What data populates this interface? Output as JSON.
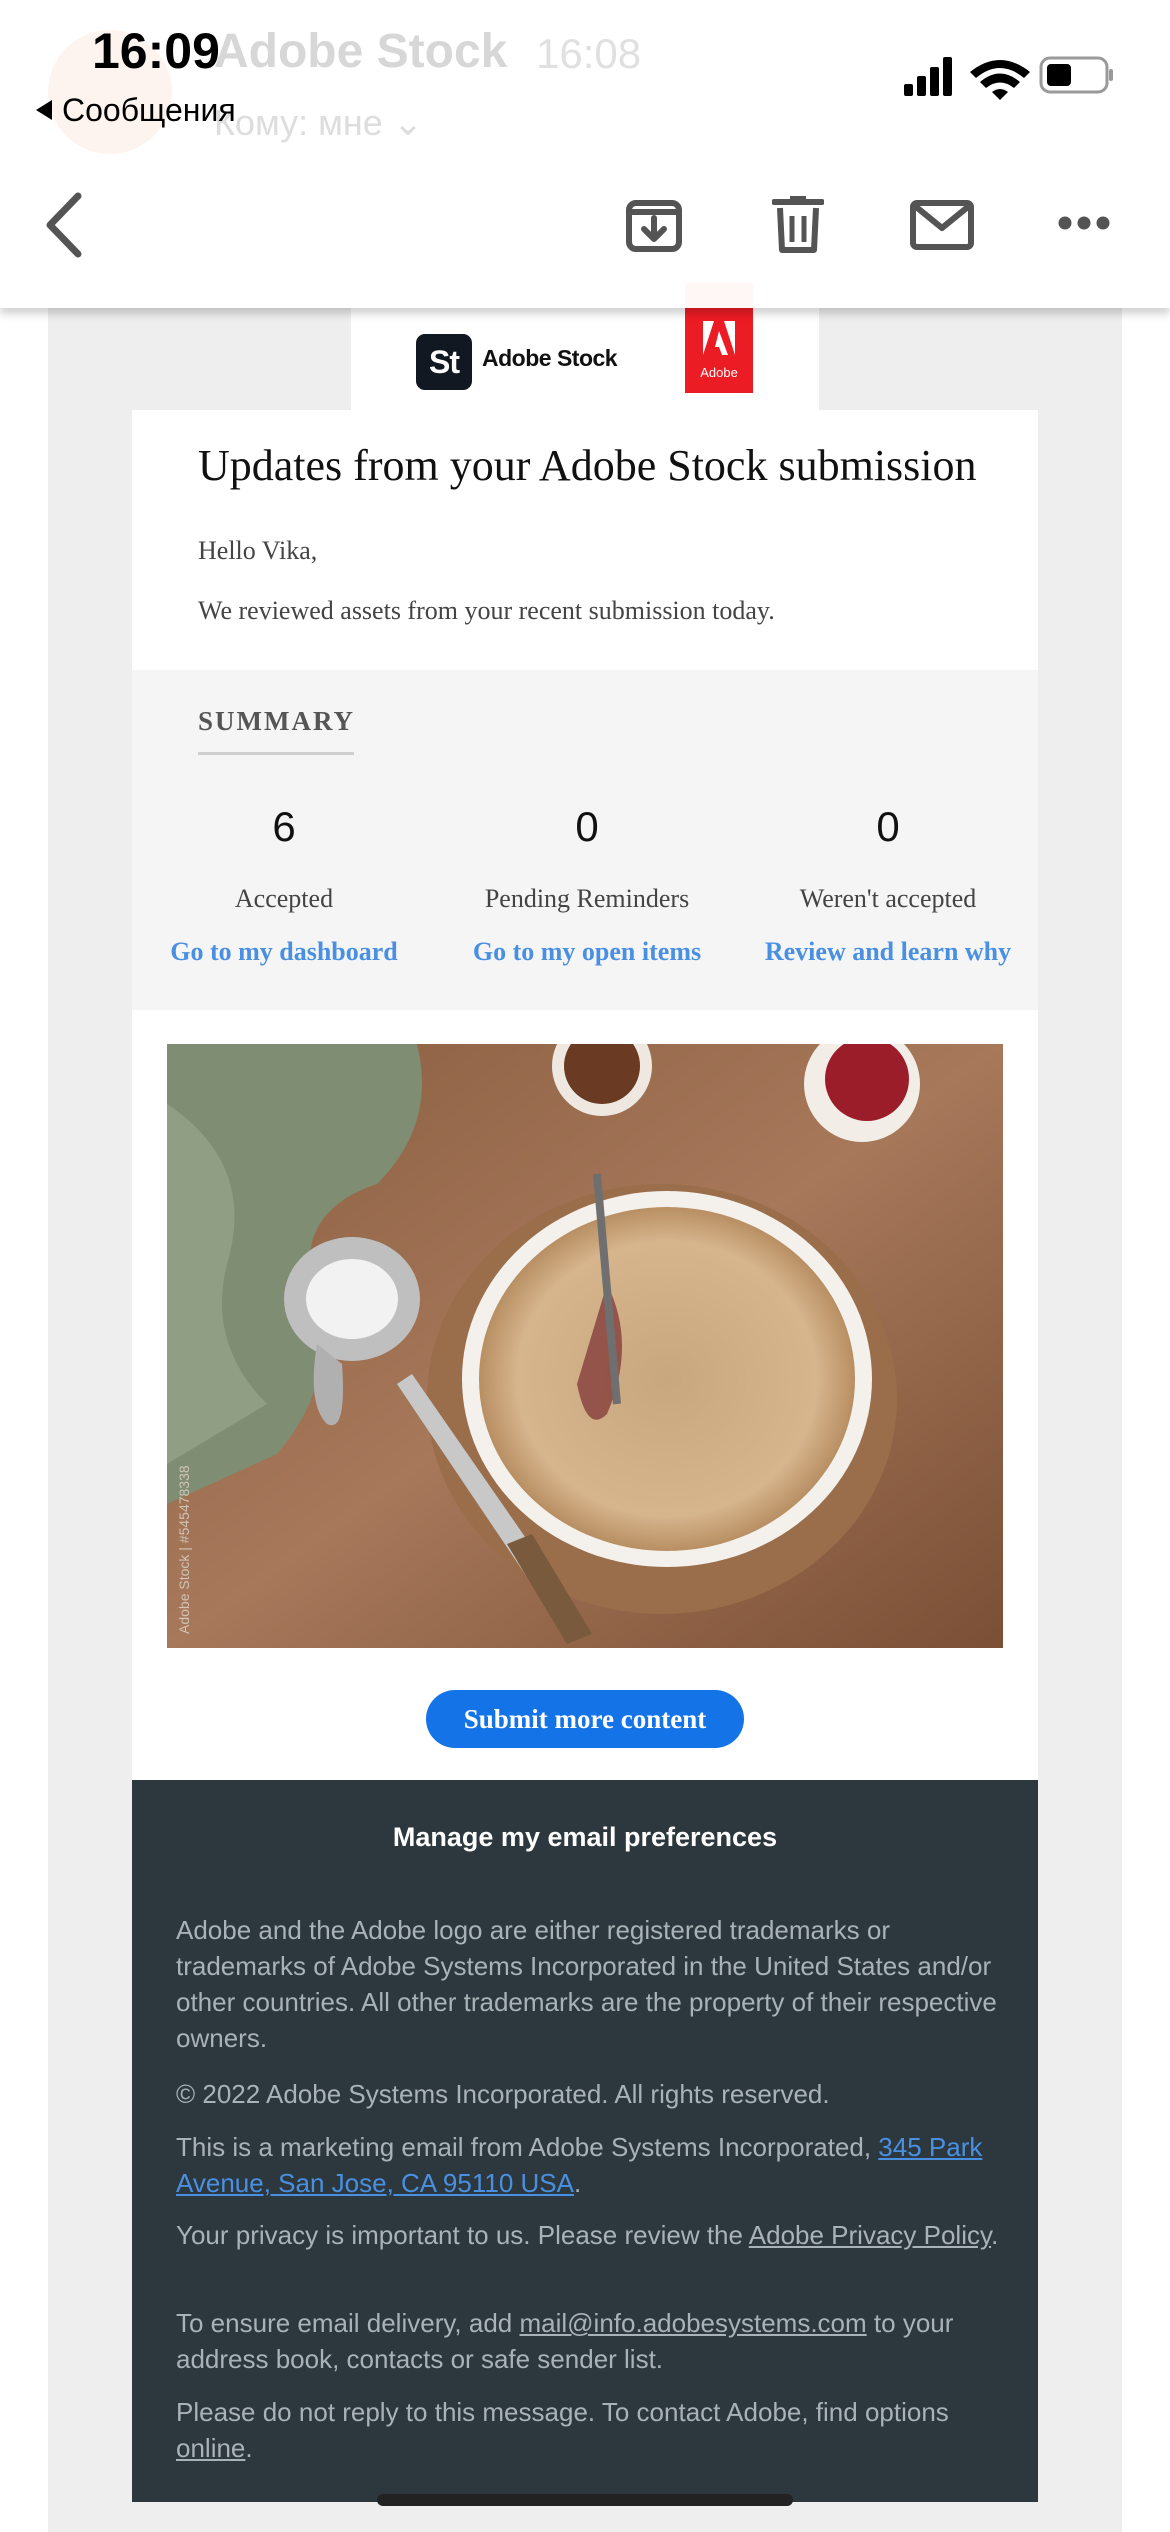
{
  "status_bar": {
    "time": "16:09",
    "back_app_label": "Сообщения"
  },
  "message_header": {
    "sender": "Adobe Stock",
    "time": "16:08",
    "recipient": "Кому: мне"
  },
  "toolbar": {
    "icons": [
      "chevron-left-icon",
      "archive-icon",
      "trash-icon",
      "envelope-icon",
      "more-icon"
    ]
  },
  "email": {
    "brand_name": "Adobe Stock",
    "brand_badge": "St",
    "adobe_logo_text": "Adobe",
    "headline": "Updates from your Adobe Stock submission",
    "greeting": "Hello Vika,",
    "intro": "We reviewed assets from your recent submission today.",
    "summary": {
      "title": "SUMMARY",
      "stats": [
        {
          "value": "6",
          "label": "Accepted",
          "link": "Go to my dashboard"
        },
        {
          "value": "0",
          "label": "Pending Reminders",
          "link": "Go to my open items"
        },
        {
          "value": "0",
          "label": "Weren't accepted",
          "link": "Review and learn why"
        }
      ]
    },
    "photo_watermark": "Adobe Stock | #545478338",
    "submit_button": "Submit more content"
  },
  "footer": {
    "manage_link": "Manage my email preferences",
    "trademark": "Adobe and the Adobe logo are either registered trademarks or trademarks of Adobe Systems Incorporated in the United States and/or other countries. All other trademarks are the property of their respective owners.",
    "copyright": "© 2022 Adobe Systems Incorporated. All rights reserved.",
    "marketing_prefix": "This is a marketing email from Adobe Systems Incorporated, ",
    "address": "345 Park Avenue, San Jose, CA 95110 USA",
    "privacy_prefix": "Your privacy is important to us. Please review the ",
    "privacy_link": "Adobe Privacy Policy",
    "delivery_prefix": "To ensure email delivery, add ",
    "delivery_email": "mail@info.adobesystems.com",
    "delivery_suffix": " to your address book, contacts or safe sender list.",
    "noreply_prefix": "Please do not reply to this message. To contact Adobe, find options ",
    "noreply_link": "online",
    "period": "."
  },
  "colors": {
    "link_blue": "#4a90e2",
    "button_blue": "#1473e6",
    "footer_bg": "#2c383d",
    "adobe_red": "#ec1c24"
  }
}
